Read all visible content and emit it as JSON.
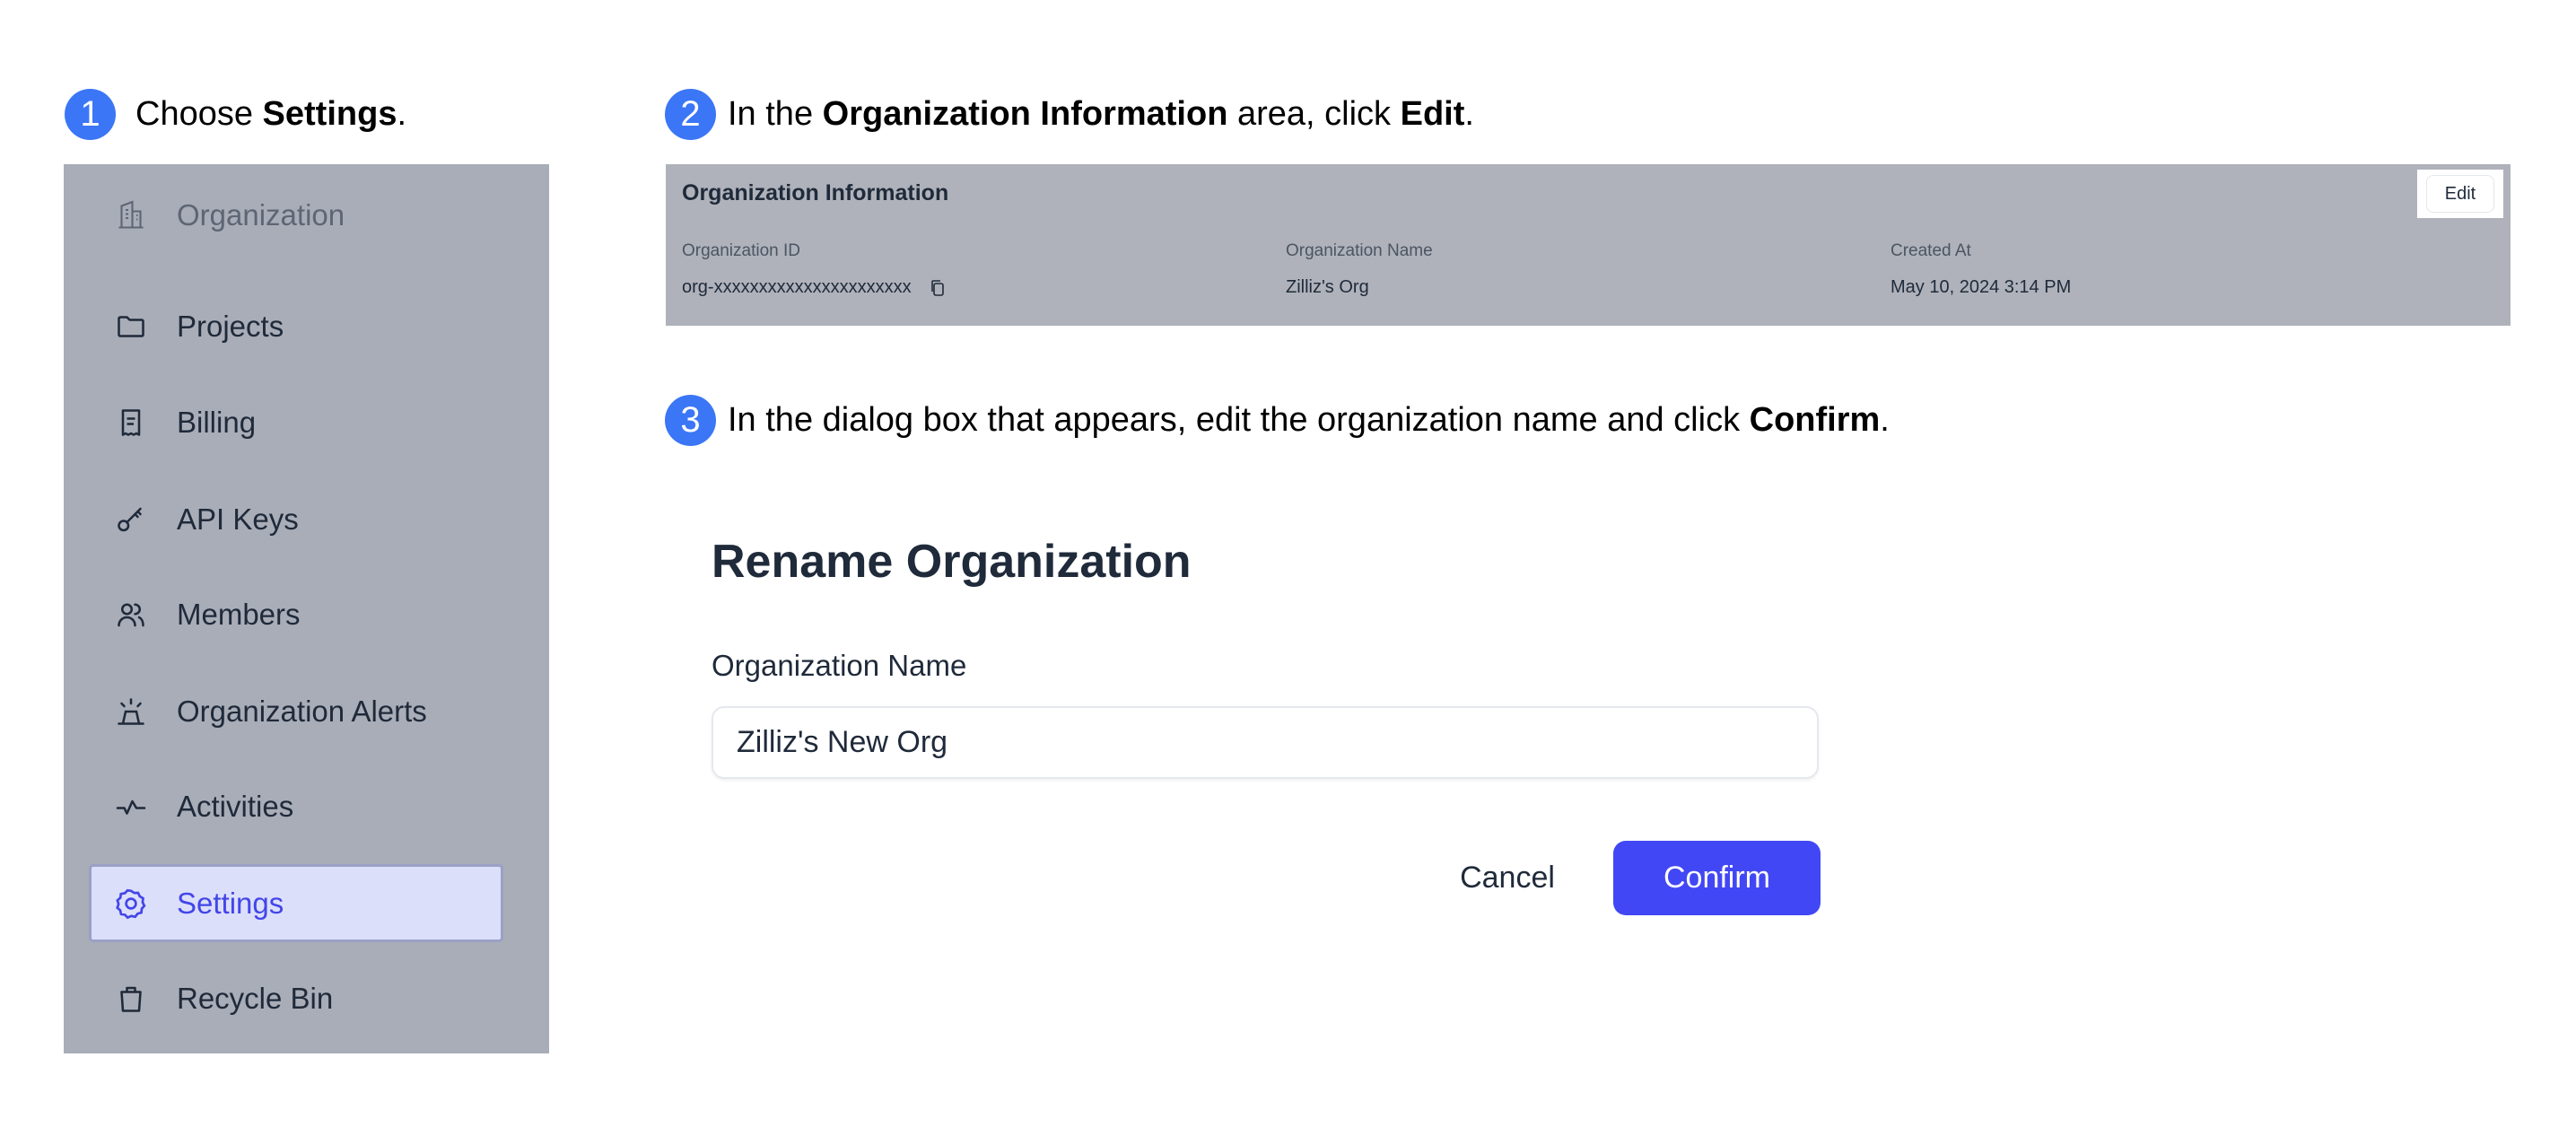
{
  "steps": [
    {
      "number": "1",
      "prefix": "Choose ",
      "bold": "Settings",
      "suffix": "."
    },
    {
      "number": "2",
      "prefix": "In the ",
      "bold": "Organization Information",
      "middle": " area, click ",
      "bold2": "Edit",
      "suffix": "."
    },
    {
      "number": "3",
      "prefix": "In the dialog box that appears, edit the organization name and click ",
      "bold": "Confirm",
      "suffix": "."
    }
  ],
  "sidebar": {
    "header": {
      "label": "Organization",
      "icon": "building-icon"
    },
    "items": [
      {
        "label": "Projects",
        "icon": "folder-icon"
      },
      {
        "label": "Billing",
        "icon": "receipt-icon"
      },
      {
        "label": "API Keys",
        "icon": "key-icon"
      },
      {
        "label": "Members",
        "icon": "users-icon"
      },
      {
        "label": "Organization Alerts",
        "icon": "siren-icon"
      },
      {
        "label": "Activities",
        "icon": "activity-icon"
      },
      {
        "label": "Settings",
        "icon": "gear-icon",
        "active": true
      },
      {
        "label": "Recycle Bin",
        "icon": "trash-icon"
      }
    ]
  },
  "org_info": {
    "title": "Organization Information",
    "edit_label": "Edit",
    "fields": [
      {
        "label": "Organization ID",
        "value": "org-xxxxxxxxxxxxxxxxxxxxxx"
      },
      {
        "label": "Organization Name",
        "value": "Zilliz's Org"
      },
      {
        "label": "Created At",
        "value": "May 10, 2024 3:14 PM"
      }
    ]
  },
  "dialog": {
    "title": "Rename Organization",
    "field_label": "Organization Name",
    "field_value": "Zilliz's New Org",
    "cancel_label": "Cancel",
    "confirm_label": "Confirm"
  },
  "colors": {
    "step_badge": "#3b76f6",
    "accent": "#4247f5",
    "active_item_bg": "#dcdffa",
    "active_item_text": "#4246e8",
    "overlay_gray": "#a9adb7"
  }
}
